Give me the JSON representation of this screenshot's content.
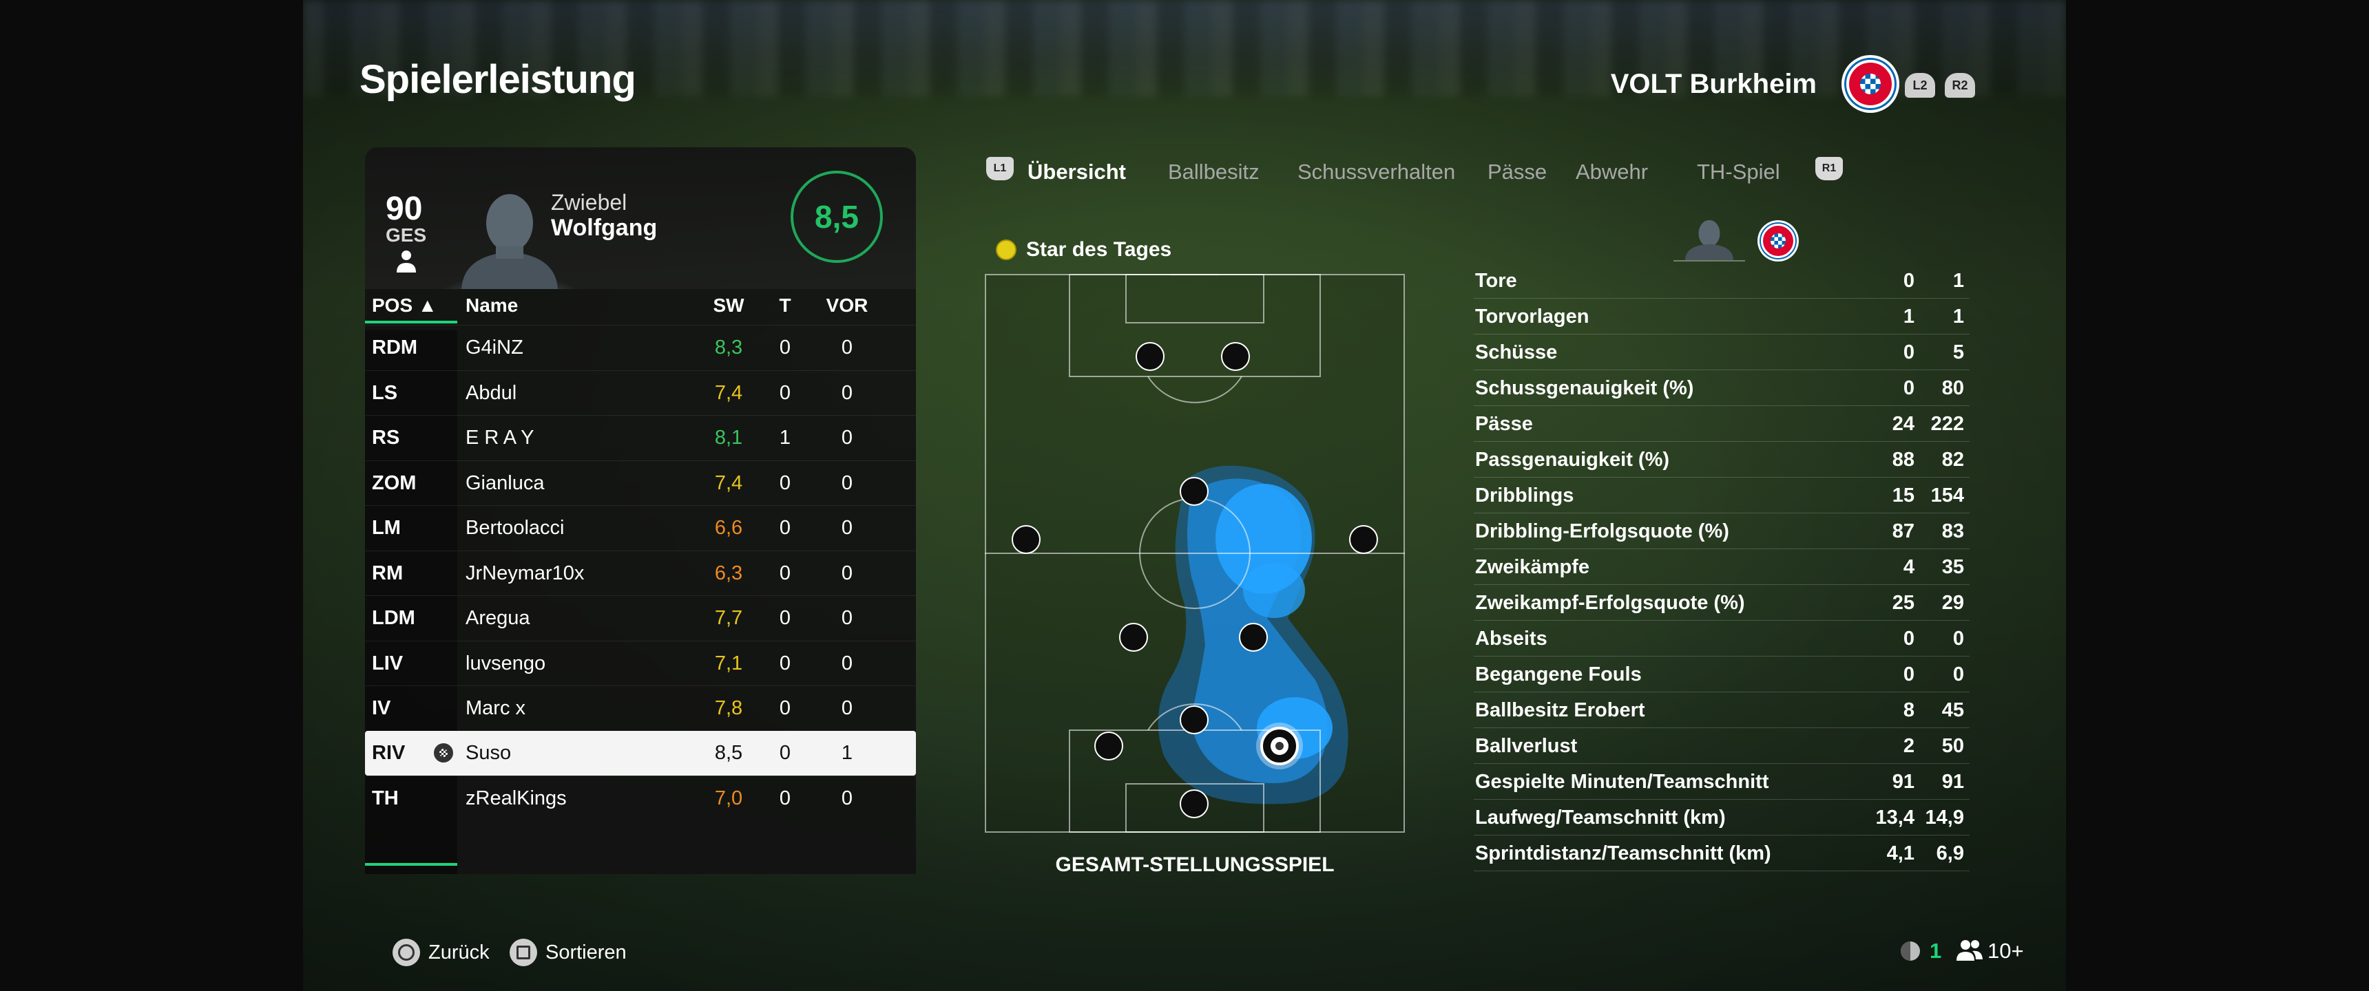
{
  "screen": {
    "title": "Spielerleistung",
    "club_name": "VOLT Burkheim"
  },
  "controller_hints": {
    "l2": "L2",
    "r2": "R2",
    "l1": "L1",
    "r1": "R1"
  },
  "player_card": {
    "overall": "90",
    "overall_label": "GES",
    "first_name": "Zwiebel",
    "last_name": "Wolfgang",
    "match_rating": "8,5"
  },
  "table": {
    "headers": {
      "pos": "POS ▲",
      "name": "Name",
      "sw": "SW",
      "t": "T",
      "vor": "VOR"
    },
    "rows": [
      {
        "pos": "RDM",
        "name": "G4iNZ",
        "sw": "8,3",
        "t": "0",
        "vor": "0",
        "sw_color": "#3dc45e"
      },
      {
        "pos": "LS",
        "name": "Abdul",
        "sw": "7,4",
        "t": "0",
        "vor": "0",
        "sw_color": "#e8c51d"
      },
      {
        "pos": "RS",
        "name": "E R A Y",
        "sw": "8,1",
        "t": "1",
        "vor": "0",
        "sw_color": "#3dc45e"
      },
      {
        "pos": "ZOM",
        "name": "Gianluca",
        "sw": "7,4",
        "t": "0",
        "vor": "0",
        "sw_color": "#e8c51d"
      },
      {
        "pos": "LM",
        "name": "Bertoolacci",
        "sw": "6,6",
        "t": "0",
        "vor": "0",
        "sw_color": "#ef8a22"
      },
      {
        "pos": "RM",
        "name": "JrNeymar10x",
        "sw": "6,3",
        "t": "0",
        "vor": "0",
        "sw_color": "#ef8a22"
      },
      {
        "pos": "LDM",
        "name": "Aregua",
        "sw": "7,7",
        "t": "0",
        "vor": "0",
        "sw_color": "#e8c51d"
      },
      {
        "pos": "LIV",
        "name": "luvsengo",
        "sw": "7,1",
        "t": "0",
        "vor": "0",
        "sw_color": "#e8c51d"
      },
      {
        "pos": "IV",
        "name": "Marc x",
        "sw": "7,8",
        "t": "0",
        "vor": "0",
        "sw_color": "#e8c51d"
      },
      {
        "pos": "RIV",
        "name": "Suso",
        "sw": "8,5",
        "t": "0",
        "vor": "1",
        "sw_color": "#111111",
        "selected": true
      },
      {
        "pos": "TH",
        "name": "zRealKings",
        "sw": "7,0",
        "t": "0",
        "vor": "0",
        "sw_color": "#ef8a22"
      }
    ]
  },
  "tabs": [
    {
      "label": "Übersicht",
      "active": true
    },
    {
      "label": "Ballbesitz"
    },
    {
      "label": "Schussverhalten"
    },
    {
      "label": "Pässe"
    },
    {
      "label": "Abwehr"
    },
    {
      "label": "TH-Spiel"
    }
  ],
  "star_of_day": "Star des Tages",
  "pitch_caption": "GESAMT-STELLUNGSSPIEL",
  "stats": [
    {
      "label": "Tore",
      "player": "0",
      "team": "1"
    },
    {
      "label": "Torvorlagen",
      "player": "1",
      "team": "1"
    },
    {
      "label": "Schüsse",
      "player": "0",
      "team": "5"
    },
    {
      "label": "Schussgenauigkeit (%)",
      "player": "0",
      "team": "80"
    },
    {
      "label": "Pässe",
      "player": "24",
      "team": "222"
    },
    {
      "label": "Passgenauigkeit (%)",
      "player": "88",
      "team": "82"
    },
    {
      "label": "Dribblings",
      "player": "15",
      "team": "154"
    },
    {
      "label": "Dribbling-Erfolgsquote (%)",
      "player": "87",
      "team": "83"
    },
    {
      "label": "Zweikämpfe",
      "player": "4",
      "team": "35"
    },
    {
      "label": "Zweikampf-Erfolgsquote (%)",
      "player": "25",
      "team": "29"
    },
    {
      "label": "Abseits",
      "player": "0",
      "team": "0"
    },
    {
      "label": "Begangene Fouls",
      "player": "0",
      "team": "0"
    },
    {
      "label": "Ballbesitz Erobert",
      "player": "8",
      "team": "45"
    },
    {
      "label": "Ballverlust",
      "player": "2",
      "team": "50"
    },
    {
      "label": "Gespielte Minuten/Teamschnitt",
      "player": "91",
      "team": "91"
    },
    {
      "label": "Laufweg/Teamschnitt (km)",
      "player": "13,4",
      "team": "14,9"
    },
    {
      "label": "Sprintdistanz/Teamschnitt (km)",
      "player": "4,1",
      "team": "6,9"
    }
  ],
  "footer": {
    "back": "Zurück",
    "sort": "Sortieren",
    "party_count": "1",
    "online": "10+"
  },
  "colors": {
    "accent_green": "#1fd37a",
    "rating_ring": "#1fa85a",
    "heat": "#1e9bff"
  }
}
